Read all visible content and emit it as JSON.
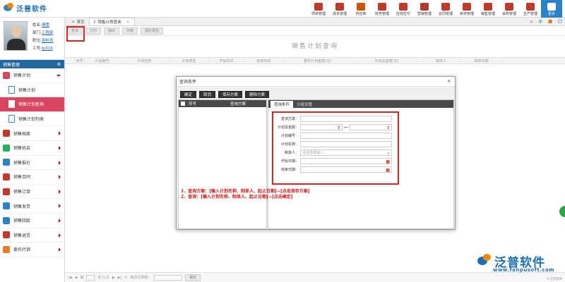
{
  "app": {
    "logo_text": "泛普软件"
  },
  "header": {
    "modules": [
      {
        "label": "项目管理",
        "color": "#c0392b"
      },
      {
        "label": "成本管理",
        "color": "#c0392b"
      },
      {
        "label": "供应商",
        "color": "#d35400"
      },
      {
        "label": "财务管理",
        "color": "#c0392b"
      },
      {
        "label": "应收应付",
        "color": "#c0392b"
      },
      {
        "label": "营销管理",
        "color": "#b03a2e"
      },
      {
        "label": "合同管理",
        "color": "#c0392b"
      },
      {
        "label": "库存管理",
        "color": "#c0392b"
      },
      {
        "label": "销售管理",
        "color": "#c0392b"
      },
      {
        "label": "采购管理",
        "color": "#c0392b"
      },
      {
        "label": "生产管理",
        "color": "#c0392b"
      },
      {
        "label": "更多",
        "color": "#ffffff"
      }
    ]
  },
  "profile": {
    "name_label": "姓名:",
    "name_value": "傅惠",
    "dept_label": "部门:",
    "dept_value": "工程部",
    "position_label": "职位:",
    "position_value": "资料员",
    "empno_label": "工号:",
    "empno_value": "fp316"
  },
  "sidebar": {
    "header": "销售管理",
    "items": [
      {
        "label": "销售计划",
        "color": "#d9455f",
        "open": true
      },
      {
        "label": "销售计划",
        "sub": true
      },
      {
        "label": "销售计划查询",
        "sub": true,
        "active": true
      },
      {
        "label": "销售计划列表",
        "sub": true
      },
      {
        "label": "销售档案",
        "color": "#c0392b"
      },
      {
        "label": "销售机会",
        "color": "#27ae60"
      },
      {
        "label": "销售报价",
        "color": "#2c82c9"
      },
      {
        "label": "销售合同",
        "color": "#c0392b"
      },
      {
        "label": "销售订单",
        "color": "#c0392b"
      },
      {
        "label": "销售发货",
        "color": "#2c82c9"
      },
      {
        "label": "销售回款",
        "color": "#2c82c9"
      },
      {
        "label": "销售退货",
        "color": "#c0392b"
      },
      {
        "label": "委托代销",
        "color": "#e67e22"
      }
    ]
  },
  "tabs": {
    "home": "首页",
    "active": "销售计划查询",
    "close": "×"
  },
  "toolbar": {
    "query": "查询",
    "print": "打印",
    "export": "输出",
    "columns": "列表",
    "chart": "图形报告"
  },
  "page": {
    "title": "销售计划查询"
  },
  "grid": {
    "columns": [
      "序号",
      "计划编号",
      "计划名称",
      "计划类型",
      "开始时间",
      "结束时间",
      "要务计划金额(元)",
      "计划总金额(元)",
      "制单人",
      "制单日期"
    ]
  },
  "pager": {
    "page_label": "第",
    "page_of": "共 0 页",
    "page_size_label": "每页记录数：",
    "confirm": "确定"
  },
  "modal": {
    "title": "查询条件",
    "close": "×",
    "buttons": [
      "确定",
      "取消",
      "保存方案",
      "删除方案"
    ],
    "scheme_col_index": "序号",
    "scheme_col_name": "查询方案",
    "tabs": [
      "查询条件",
      "分组设置"
    ],
    "fields": [
      {
        "label": "查询方案：",
        "value": ""
      },
      {
        "label": "计划总金额：",
        "value": ""
      },
      {
        "label": "计划编号：",
        "value": ""
      },
      {
        "label": "计划名称：",
        "value": ""
      },
      {
        "label": "制单人：",
        "value": "",
        "placeholder": "请选择或输入"
      },
      {
        "label": "开始日期：",
        "value": ""
      },
      {
        "label": "结束日期：",
        "value": ""
      }
    ],
    "notes": [
      "1、查询方案：[输入计划名称、制单人、起止日期]→[点击保存方案]",
      "2、查询：[输入计划名称、制单人、起止日期]→[点击确定]"
    ]
  },
  "brand": {
    "name": "泛普软件",
    "url": "www.fanpusoft.com",
    "copyright": "©泛普软件"
  }
}
